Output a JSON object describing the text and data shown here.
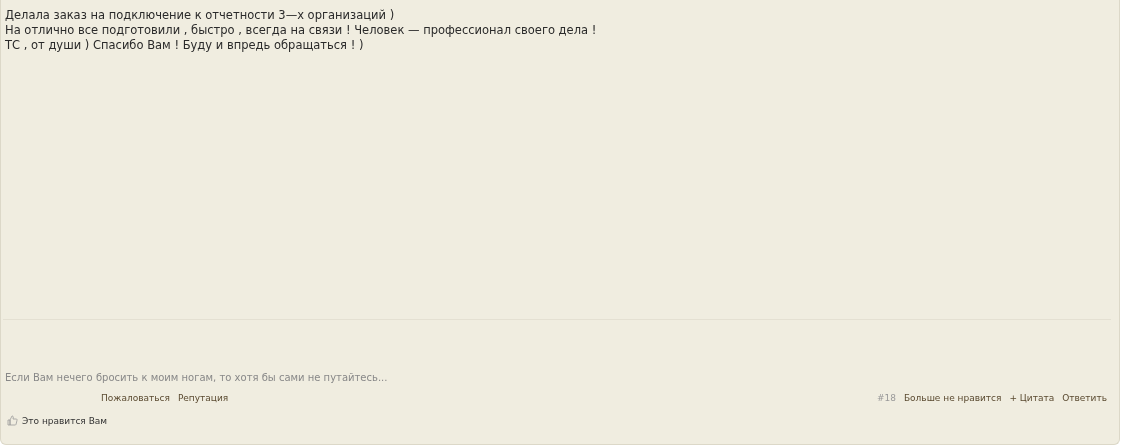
{
  "message": {
    "lines": [
      "Делала заказ на подключение к отчетности 3—х организаций )",
      "На отлично все подготовили , быстро , всегда на связи ! Человек — профессионал своего дела !",
      "ТС , от души ) Спасибо Вам ! Буду и впредь обращаться ! )"
    ]
  },
  "signature": "Если Вам нечего бросить к моим ногам, то хотя бы сами не путайтесь...",
  "left_links": [
    "Пожаловаться",
    "Репутация"
  ],
  "post_number": "#18",
  "right_links": [
    "Больше не нравится",
    "+ Цитата",
    "Ответить"
  ],
  "likes": "Это нравится Вам"
}
